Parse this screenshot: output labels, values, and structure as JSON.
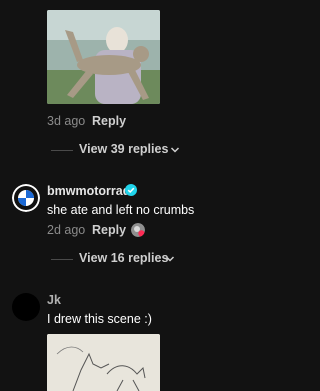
{
  "comment1": {
    "timestamp": "3d ago",
    "reply_label": "Reply",
    "view_replies": "View 39 replies"
  },
  "comment2": {
    "username": "bmwmotorrad",
    "text": "she ate and left no crumbs",
    "timestamp": "2d ago",
    "reply_label": "Reply",
    "view_replies": "View 16 replies",
    "verified_color": "#20d5ec"
  },
  "comment3": {
    "username": "Jk",
    "text": "I drew this scene :)"
  },
  "icons": {
    "expand": "chevron-down-icon",
    "verified": "verified-badge-icon"
  }
}
